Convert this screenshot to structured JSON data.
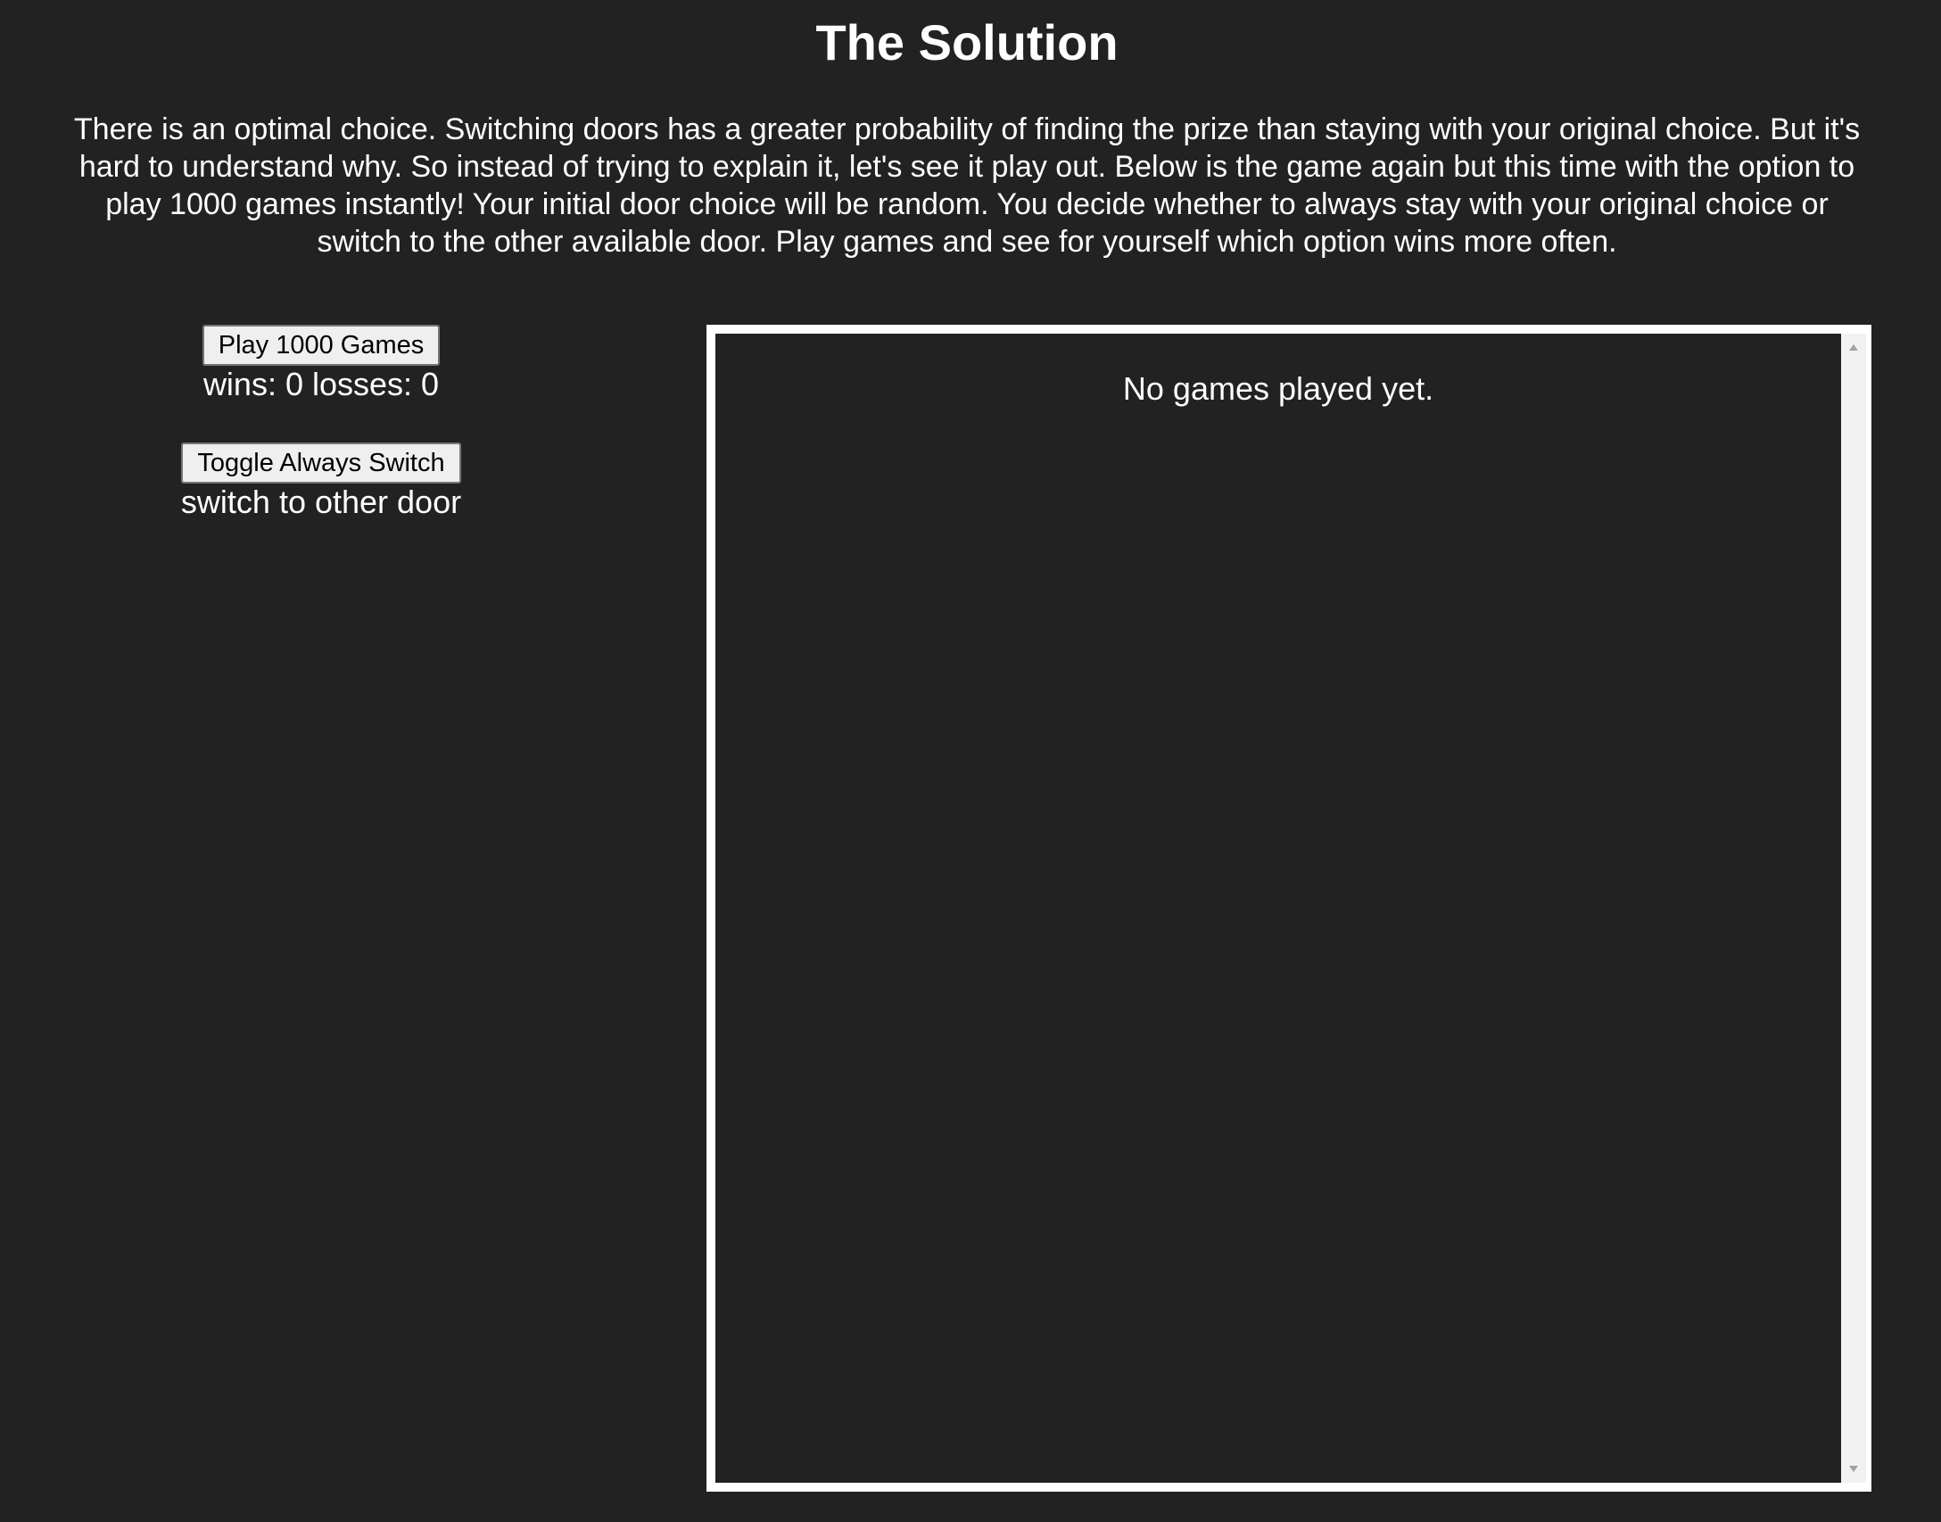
{
  "page": {
    "title": "The Solution",
    "intro": "There is an optimal choice. Switching doors has a greater probability of finding the prize than staying with your original choice. But it's hard to understand why. So instead of trying to explain it, let's see it play out. Below is the game again but this time with the option to play 1000 games instantly! Your initial door choice will be random. You decide whether to always stay with your original choice or switch to the other available door. Play games and see for yourself which option wins more often."
  },
  "controls": {
    "play_button_label": "Play 1000 Games",
    "score_text": "wins: 0 losses: 0",
    "toggle_button_label": "Toggle Always Switch",
    "mode_text": "switch to other door"
  },
  "results": {
    "empty_message": "No games played yet."
  },
  "colors": {
    "background": "#222222",
    "text": "#ffffff",
    "panel_border": "#ffffff",
    "button_bg": "#efefef"
  }
}
